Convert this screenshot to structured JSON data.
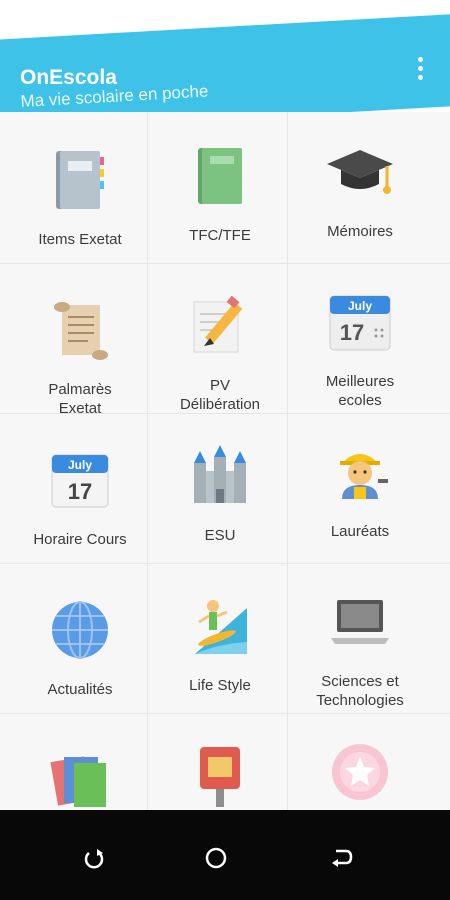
{
  "app": {
    "title": "OnEscola",
    "subtitle": "Ma vie scolaire en poche",
    "accent": "#3fc2e8"
  },
  "grid": {
    "items": [
      {
        "label": "Items Exetat",
        "icon": "notebook-icon"
      },
      {
        "label": "TFC/TFE",
        "icon": "green-book-icon"
      },
      {
        "label": "Mémoires",
        "icon": "graduation-cap-icon"
      },
      {
        "label": "Palmarès\nExetat",
        "icon": "scroll-icon"
      },
      {
        "label": "PV\nDélibération",
        "icon": "pencil-paper-icon"
      },
      {
        "label": "Meilleures\necoles",
        "icon": "calendar-icon",
        "calendar": {
          "month": "July",
          "day": "17"
        }
      },
      {
        "label": "Horaire Cours",
        "icon": "calendar-icon",
        "calendar": {
          "month": "July",
          "day": "17"
        }
      },
      {
        "label": "ESU",
        "icon": "castle-icon"
      },
      {
        "label": "Lauréats",
        "icon": "construction-worker-icon"
      },
      {
        "label": "Actualités",
        "icon": "globe-icon"
      },
      {
        "label": "Life Style",
        "icon": "surfer-icon"
      },
      {
        "label": "Sciences et\nTechnologies",
        "icon": "laptop-icon"
      },
      {
        "label": "",
        "icon": "books-icon"
      },
      {
        "label": "",
        "icon": "postbox-icon"
      },
      {
        "label": "",
        "icon": "flower-icon"
      }
    ]
  },
  "nav": {
    "buttons": [
      "recent-apps-icon",
      "home-icon",
      "back-icon"
    ]
  }
}
